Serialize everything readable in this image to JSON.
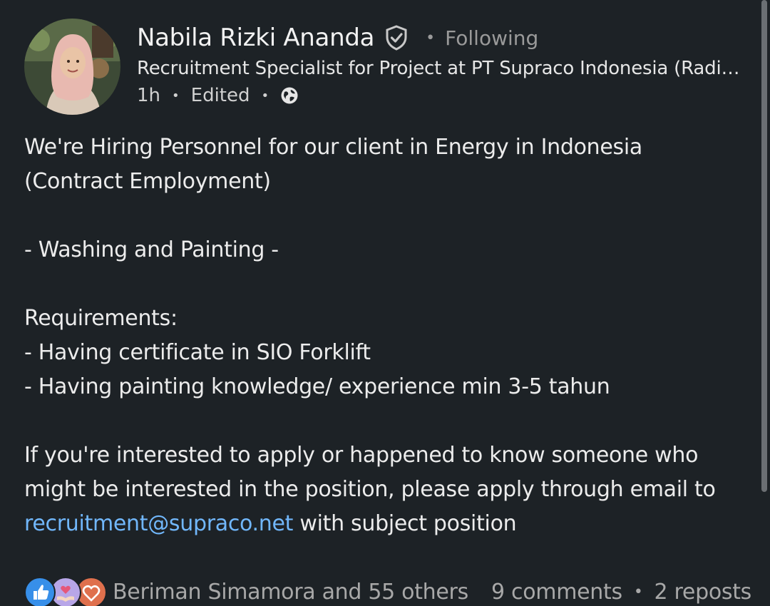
{
  "author": {
    "name": "Nabila Rizki Ananda",
    "follow_status": "Following",
    "headline": "Recruitment Specialist for Project at PT Supraco Indonesia (Radiant Utama Interinsco Group)",
    "time": "1h",
    "edited_label": "Edited",
    "visibility_icon": "globe-icon",
    "verified_icon": "verified-shield-icon"
  },
  "post": {
    "line1": "We're Hiring Personnel for our client in Energy in Indonesia (Contract Employment)",
    "position": "- Washing and Painting -",
    "requirements_heading": "Requirements:",
    "requirement_1": "- Having certificate in SIO Forklift",
    "requirement_2": "- Having painting knowledge/ experience min 3-5 tahun",
    "closing_text": "If you're interested to apply or happened to know someone who might be interested in the position, please apply through email to",
    "email": "recruitment@supraco.net",
    "closing_suffix": " with subject position"
  },
  "social": {
    "reactions_text": "Beriman Simamora and 55 others",
    "comments": "9 comments",
    "reposts": "2 reposts",
    "reaction_icons": [
      "like-icon",
      "support-icon",
      "love-icon"
    ]
  },
  "colors": {
    "background": "#1d2226",
    "link": "#71b7fb",
    "like": "#378fe9",
    "support": "#b8a6e8",
    "love": "#df704d"
  }
}
